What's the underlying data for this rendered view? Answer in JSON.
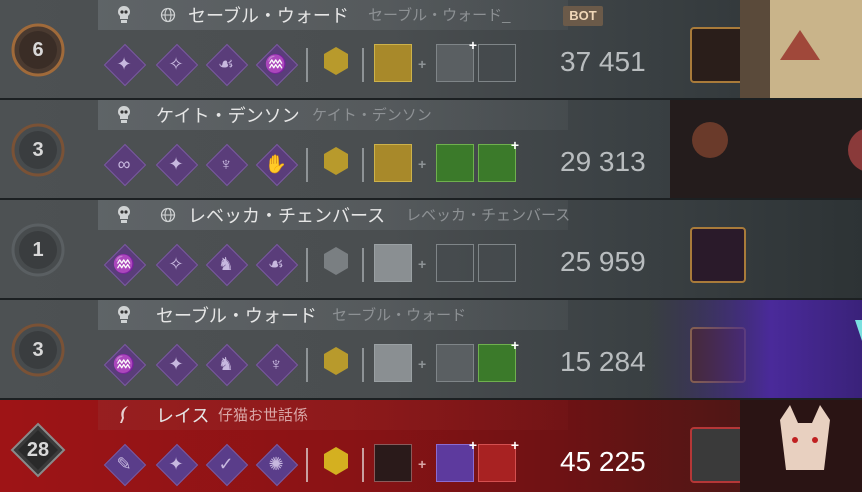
{
  "players": [
    {
      "name": "セーブル・ウォード",
      "subname": "セーブル・ウォード_",
      "badge": "BOT",
      "rank": "6",
      "score": "37 451",
      "show_globe": true,
      "role": "survivor"
    },
    {
      "name": "ケイト・デンソン",
      "subname": "ケイト・デンソン",
      "badge": "",
      "rank": "3",
      "score": "29 313",
      "show_globe": false,
      "role": "survivor"
    },
    {
      "name": "レベッカ・チェンバース",
      "subname": "レベッカ・チェンバース",
      "badge": "",
      "rank": "1",
      "score": "25 959",
      "show_globe": true,
      "role": "survivor"
    },
    {
      "name": "セーブル・ウォード",
      "subname": "セーブル・ウォード",
      "badge": "",
      "rank": "3",
      "score": "15 284",
      "show_globe": false,
      "role": "survivor"
    },
    {
      "name": "レイス",
      "subname": "仔猫お世話係",
      "badge": "",
      "rank": "28",
      "score": "45 225",
      "show_globe": false,
      "role": "killer"
    }
  ],
  "colors": {
    "perk": "#5a3d7a",
    "survivor_row": "#4d5153",
    "killer_row": "#9e1416",
    "item_yellow": "#b89a2c",
    "addon_green": "#3b7a2a",
    "addon_purple": "#5d3a9e",
    "addon_red": "#a82222"
  },
  "icons": {
    "role_survivor": "skull-icon",
    "role_killer": "sickle-icon",
    "crossplay": "globe-icon",
    "add": "plus-icon"
  }
}
